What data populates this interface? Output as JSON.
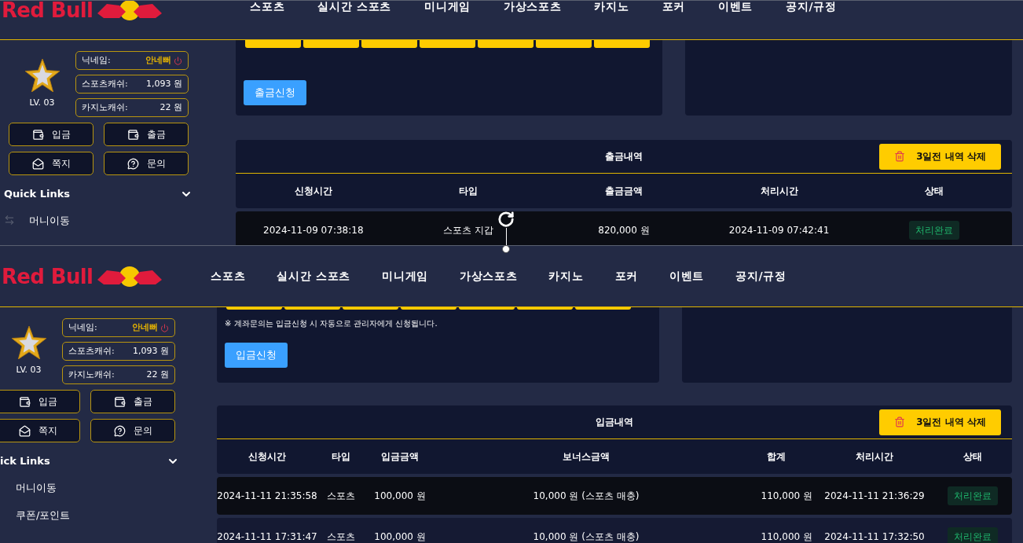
{
  "panes": [
    {
      "header": {
        "logo": "Red Bull",
        "nav": [
          "스포츠",
          "실시간 스포츠",
          "미니게임",
          "가상스포츠",
          "카지노",
          "포커",
          "이벤트",
          "공지/규정"
        ]
      },
      "sidebar": {
        "level": "LV. 03",
        "fields": [
          {
            "label": "닉네임:",
            "value": "안네뻐",
            "kind": "nickname"
          },
          {
            "label": "스포츠캐쉬:",
            "value": "1,093 원",
            "kind": "cash"
          },
          {
            "label": "카지노캐쉬:",
            "value": "22 원",
            "kind": "cash"
          }
        ],
        "buttons": [
          {
            "label": "입금",
            "kind": "deposit"
          },
          {
            "label": "출금",
            "kind": "withdraw"
          },
          {
            "label": "쪽지",
            "kind": "message"
          },
          {
            "label": "문의",
            "kind": "inquiry"
          }
        ],
        "quick_links": {
          "title": "Quick Links",
          "items": [
            "머니이동"
          ]
        }
      },
      "form": {
        "submit": "출금신청"
      },
      "table": {
        "title": "출금내역",
        "delete_button": "3일전 내역 삭제",
        "columns": [
          "신청시간",
          "타입",
          "출금금액",
          "처리시간",
          "상태"
        ],
        "rows": [
          {
            "cells": [
              "2024-11-09 07:38:18",
              "스포츠 지갑",
              "820,000 원",
              "2024-11-09 07:42:41"
            ],
            "status": "처리완료"
          }
        ]
      }
    },
    {
      "header": {
        "logo": "Red Bull",
        "nav": [
          "스포츠",
          "실시간 스포츠",
          "미니게임",
          "가상스포츠",
          "카지노",
          "포커",
          "이벤트",
          "공지/규정"
        ]
      },
      "sidebar": {
        "level": "LV. 03",
        "fields": [
          {
            "label": "닉네임:",
            "value": "안네뻐",
            "kind": "nickname"
          },
          {
            "label": "스포츠캐쉬:",
            "value": "1,093 원",
            "kind": "cash"
          },
          {
            "label": "카지노캐쉬:",
            "value": "22 원",
            "kind": "cash"
          }
        ],
        "buttons": [
          {
            "label": "입금",
            "kind": "deposit"
          },
          {
            "label": "출금",
            "kind": "withdraw"
          },
          {
            "label": "쪽지",
            "kind": "message"
          },
          {
            "label": "문의",
            "kind": "inquiry"
          }
        ],
        "quick_links": {
          "title": "ick Links",
          "items": [
            "머니이동",
            "쿠폰/포인트"
          ]
        }
      },
      "form": {
        "note": "※ 계좌문의는 입금신청 시 자동으로 관리자에게 신청됩니다.",
        "submit": "입금신청"
      },
      "table": {
        "title": "입금내역",
        "delete_button": "3일전 내역 삭제",
        "columns": [
          "신청시간",
          "타입",
          "입금금액",
          "보너스금액",
          "합계",
          "처리시간",
          "상태"
        ],
        "rows": [
          {
            "cells": [
              "2024-11-11 21:35:58",
              "스포츠",
              "100,000 원",
              "10,000 원 (스포츠 매충)",
              "110,000 원",
              "2024-11-11 21:36:29"
            ],
            "status": "처리완료"
          },
          {
            "cells": [
              "2024-11-11 17:31:47",
              "스포츠",
              "100,000 원",
              "10,000 원 (스포츠 매충)",
              "110,000 원",
              "2024-11-11 17:32:50"
            ],
            "status": "처리완료"
          }
        ]
      }
    }
  ]
}
